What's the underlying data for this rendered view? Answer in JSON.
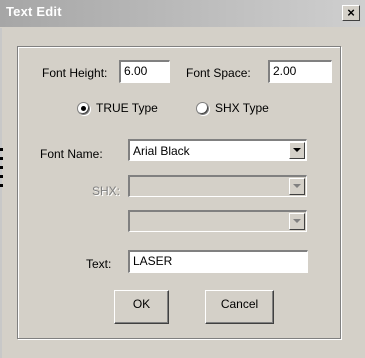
{
  "window": {
    "title": "Text Edit",
    "close_glyph": "×"
  },
  "form": {
    "font_height_label": "Font Height:",
    "font_height_value": "6.00",
    "font_space_label": "Font Space:",
    "font_space_value": "2.00",
    "type_options": [
      {
        "label": "TRUE Type",
        "selected": true
      },
      {
        "label": "SHX Type",
        "selected": false
      }
    ],
    "font_name_label": "Font Name:",
    "font_name_value": "Arial Black",
    "shx_label": "SHX:",
    "shx_value": "",
    "shx2_value": "",
    "text_label": "Text:",
    "text_value": "LASER"
  },
  "buttons": {
    "ok_label": "OK",
    "cancel_label": "Cancel"
  },
  "icons": {
    "close": "close-icon",
    "dropdown": "chevron-down-icon",
    "radio_on": "radio-selected-icon",
    "radio_off": "radio-unselected-icon"
  }
}
